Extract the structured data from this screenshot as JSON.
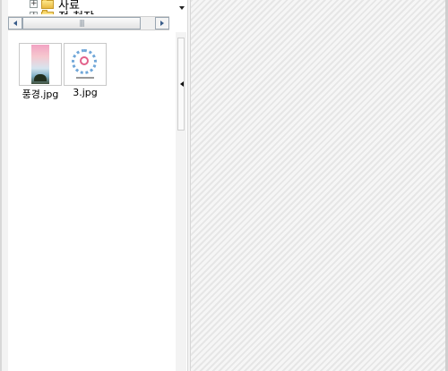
{
  "tree": {
    "items": [
      {
        "label": "사료",
        "expander": "+"
      },
      {
        "label": "적 청장",
        "expander": "+"
      }
    ]
  },
  "scrollbar": {
    "grip": "|||"
  },
  "thumbnails": [
    {
      "filename": "풍경.jpg",
      "icon": "landscape-image-icon"
    },
    {
      "filename": "3.jpg",
      "icon": "document-image-icon"
    }
  ],
  "colors": {
    "preview_background": "#ececec",
    "pane_background": "#ffffff"
  }
}
